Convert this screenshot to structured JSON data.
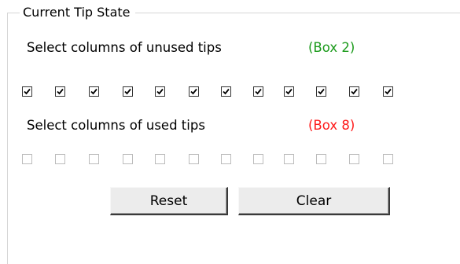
{
  "group": {
    "title": "Current Tip State"
  },
  "unused": {
    "label": "Select columns of unused tips",
    "box_tag": "(Box 2)",
    "box_tag_color": "#1a9a1a",
    "columns": [
      true,
      true,
      true,
      true,
      true,
      true,
      true,
      true,
      true,
      true,
      true,
      true
    ]
  },
  "used": {
    "label": "Select columns of used tips",
    "box_tag": "(Box 8)",
    "box_tag_color": "#ff1a1a",
    "columns": [
      false,
      false,
      false,
      false,
      false,
      false,
      false,
      false,
      false,
      false,
      false,
      false
    ]
  },
  "buttons": {
    "reset": "Reset",
    "clear": "Clear"
  }
}
